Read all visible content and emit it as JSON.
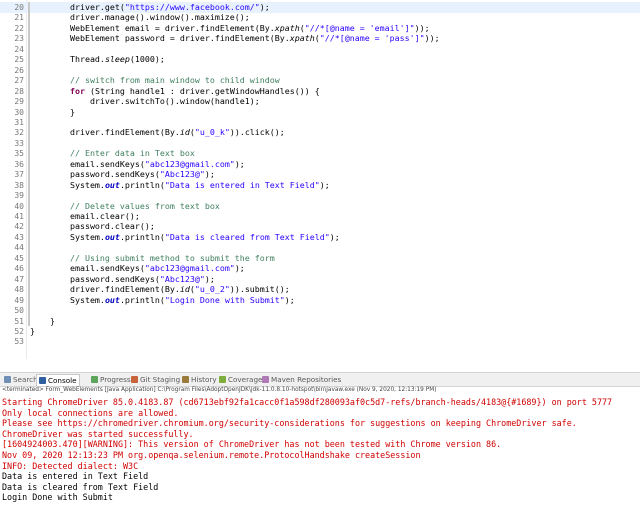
{
  "editor": {
    "lines": [
      {
        "num": "20",
        "parts": [
          {
            "t": "        driver.get(",
            "c": ""
          },
          {
            "t": "\"https://www.facebook.com/\"",
            "c": "str"
          },
          {
            "t": ");",
            "c": ""
          }
        ]
      },
      {
        "num": "21",
        "parts": [
          {
            "t": "        driver.manage().window().maximize();",
            "c": ""
          }
        ]
      },
      {
        "num": "22",
        "parts": [
          {
            "t": "        WebElement email = driver.findElement(By.",
            "c": ""
          },
          {
            "t": "xpath",
            "c": "it"
          },
          {
            "t": "(",
            "c": ""
          },
          {
            "t": "\"//*[@name = 'email']\"",
            "c": "str"
          },
          {
            "t": "));",
            "c": ""
          }
        ]
      },
      {
        "num": "23",
        "parts": [
          {
            "t": "        WebElement password = driver.findElement(By.",
            "c": ""
          },
          {
            "t": "xpath",
            "c": "it"
          },
          {
            "t": "(",
            "c": ""
          },
          {
            "t": "\"//*[@name = 'pass']\"",
            "c": "str"
          },
          {
            "t": "));",
            "c": ""
          }
        ]
      },
      {
        "num": "24",
        "parts": [
          {
            "t": "",
            "c": ""
          }
        ]
      },
      {
        "num": "25",
        "parts": [
          {
            "t": "        Thread.",
            "c": ""
          },
          {
            "t": "sleep",
            "c": "it"
          },
          {
            "t": "(1000);",
            "c": ""
          }
        ]
      },
      {
        "num": "26",
        "parts": [
          {
            "t": "",
            "c": ""
          }
        ]
      },
      {
        "num": "27",
        "parts": [
          {
            "t": "        // switch from main window to child window",
            "c": "cmt"
          }
        ]
      },
      {
        "num": "28",
        "parts": [
          {
            "t": "        ",
            "c": ""
          },
          {
            "t": "for",
            "c": "kw"
          },
          {
            "t": " (String handle1 : driver.getWindowHandles()) {",
            "c": ""
          }
        ]
      },
      {
        "num": "29",
        "parts": [
          {
            "t": "            driver.switchTo().window(handle1);",
            "c": ""
          }
        ]
      },
      {
        "num": "30",
        "parts": [
          {
            "t": "        }",
            "c": ""
          }
        ]
      },
      {
        "num": "31",
        "parts": [
          {
            "t": "",
            "c": ""
          }
        ]
      },
      {
        "num": "32",
        "parts": [
          {
            "t": "        driver.findElement(By.",
            "c": ""
          },
          {
            "t": "id",
            "c": "it"
          },
          {
            "t": "(",
            "c": ""
          },
          {
            "t": "\"u_0_k\"",
            "c": "str"
          },
          {
            "t": ")).click();",
            "c": ""
          }
        ]
      },
      {
        "num": "33",
        "parts": [
          {
            "t": "",
            "c": ""
          }
        ]
      },
      {
        "num": "35",
        "parts": [
          {
            "t": "        // Enter data in Text box",
            "c": "cmt"
          }
        ]
      },
      {
        "num": "36",
        "parts": [
          {
            "t": "        email.sendKeys(",
            "c": ""
          },
          {
            "t": "\"abc123@gmail.com\"",
            "c": "str"
          },
          {
            "t": ");",
            "c": ""
          }
        ]
      },
      {
        "num": "37",
        "parts": [
          {
            "t": "        password.sendKeys(",
            "c": ""
          },
          {
            "t": "\"Abc123@\"",
            "c": "str"
          },
          {
            "t": ");",
            "c": ""
          }
        ]
      },
      {
        "num": "38",
        "parts": [
          {
            "t": "        System.",
            "c": ""
          },
          {
            "t": "out",
            "c": "fld"
          },
          {
            "t": ".println(",
            "c": ""
          },
          {
            "t": "\"Data is entered in Text Field\"",
            "c": "str"
          },
          {
            "t": ");",
            "c": ""
          }
        ]
      },
      {
        "num": "39",
        "parts": [
          {
            "t": "",
            "c": ""
          }
        ]
      },
      {
        "num": "40",
        "parts": [
          {
            "t": "        // Delete values from text box",
            "c": "cmt"
          }
        ]
      },
      {
        "num": "41",
        "parts": [
          {
            "t": "        email.clear();",
            "c": ""
          }
        ]
      },
      {
        "num": "42",
        "parts": [
          {
            "t": "        password.clear();",
            "c": ""
          }
        ]
      },
      {
        "num": "43",
        "parts": [
          {
            "t": "        System.",
            "c": ""
          },
          {
            "t": "out",
            "c": "fld"
          },
          {
            "t": ".println(",
            "c": ""
          },
          {
            "t": "\"Data is cleared from Text Field\"",
            "c": "str"
          },
          {
            "t": ");",
            "c": ""
          }
        ]
      },
      {
        "num": "44",
        "parts": [
          {
            "t": "",
            "c": ""
          }
        ]
      },
      {
        "num": "45",
        "parts": [
          {
            "t": "        // Using submit method to submit the form",
            "c": "cmt"
          }
        ]
      },
      {
        "num": "46",
        "parts": [
          {
            "t": "        email.sendKeys(",
            "c": ""
          },
          {
            "t": "\"abc123@gmail.com\"",
            "c": "str"
          },
          {
            "t": ");",
            "c": ""
          }
        ]
      },
      {
        "num": "47",
        "parts": [
          {
            "t": "        password.sendKeys(",
            "c": ""
          },
          {
            "t": "\"Abc123@\"",
            "c": "str"
          },
          {
            "t": ");",
            "c": ""
          }
        ]
      },
      {
        "num": "48",
        "parts": [
          {
            "t": "        driver.findElement(By.",
            "c": ""
          },
          {
            "t": "id",
            "c": "it"
          },
          {
            "t": "(",
            "c": ""
          },
          {
            "t": "\"u_0_2\"",
            "c": "str"
          },
          {
            "t": ")).submit();",
            "c": ""
          }
        ]
      },
      {
        "num": "49",
        "parts": [
          {
            "t": "        System.",
            "c": ""
          },
          {
            "t": "out",
            "c": "fld"
          },
          {
            "t": ".println(",
            "c": ""
          },
          {
            "t": "\"Login Done with Submit\"",
            "c": "str"
          },
          {
            "t": ");",
            "c": ""
          }
        ]
      },
      {
        "num": "50",
        "parts": [
          {
            "t": "",
            "c": ""
          }
        ]
      },
      {
        "num": "51",
        "parts": [
          {
            "t": "    }",
            "c": ""
          }
        ]
      },
      {
        "num": "52",
        "parts": [
          {
            "t": "}",
            "c": ""
          }
        ]
      },
      {
        "num": "53",
        "parts": [
          {
            "t": "",
            "c": ""
          }
        ]
      }
    ]
  },
  "tabs": [
    {
      "label": "Search",
      "icon": "search-icon",
      "active": false
    },
    {
      "label": "Console",
      "icon": "console-icon",
      "active": true
    },
    {
      "label": "Progress",
      "icon": "progress-icon",
      "active": false
    },
    {
      "label": "Git Staging",
      "icon": "git-staging-icon",
      "active": false
    },
    {
      "label": "History",
      "icon": "history-icon",
      "active": false
    },
    {
      "label": "Coverage",
      "icon": "coverage-icon",
      "active": false
    },
    {
      "label": "Maven Repositories",
      "icon": "maven-icon",
      "active": false
    }
  ],
  "console": {
    "status": "<terminated> Form_WebElements [Java Application] C:\\Program Files\\AdoptOpenJDK\\jdk-11.0.8.10-hotspot\\bin\\javaw.exe (Nov 9, 2020, 12:13:19 PM)",
    "lines": [
      {
        "text": "Starting ChromeDriver 85.0.4183.87 (cd6713ebf92fa1cacc0f1a598df280093af0c5d7-refs/branch-heads/4183@{#1689}) on port 5777",
        "color": "red"
      },
      {
        "text": "Only local connections are allowed.",
        "color": "red"
      },
      {
        "text": "Please see https://chromedriver.chromium.org/security-considerations for suggestions on keeping ChromeDriver safe.",
        "color": "red"
      },
      {
        "text": "ChromeDriver was started successfully.",
        "color": "red"
      },
      {
        "text": "[1604924003.470][WARNING]: This version of ChromeDriver has not been tested with Chrome version 86.",
        "color": "red"
      },
      {
        "text": "Nov 09, 2020 12:13:23 PM org.openqa.selenium.remote.ProtocolHandshake createSession",
        "color": "red"
      },
      {
        "text": "INFO: Detected dialect: W3C",
        "color": "red"
      },
      {
        "text": "Data is entered in Text Field",
        "color": "blk"
      },
      {
        "text": "Data is cleared from Text Field",
        "color": "blk"
      },
      {
        "text": "Login Done with Submit",
        "color": "blk"
      }
    ]
  }
}
